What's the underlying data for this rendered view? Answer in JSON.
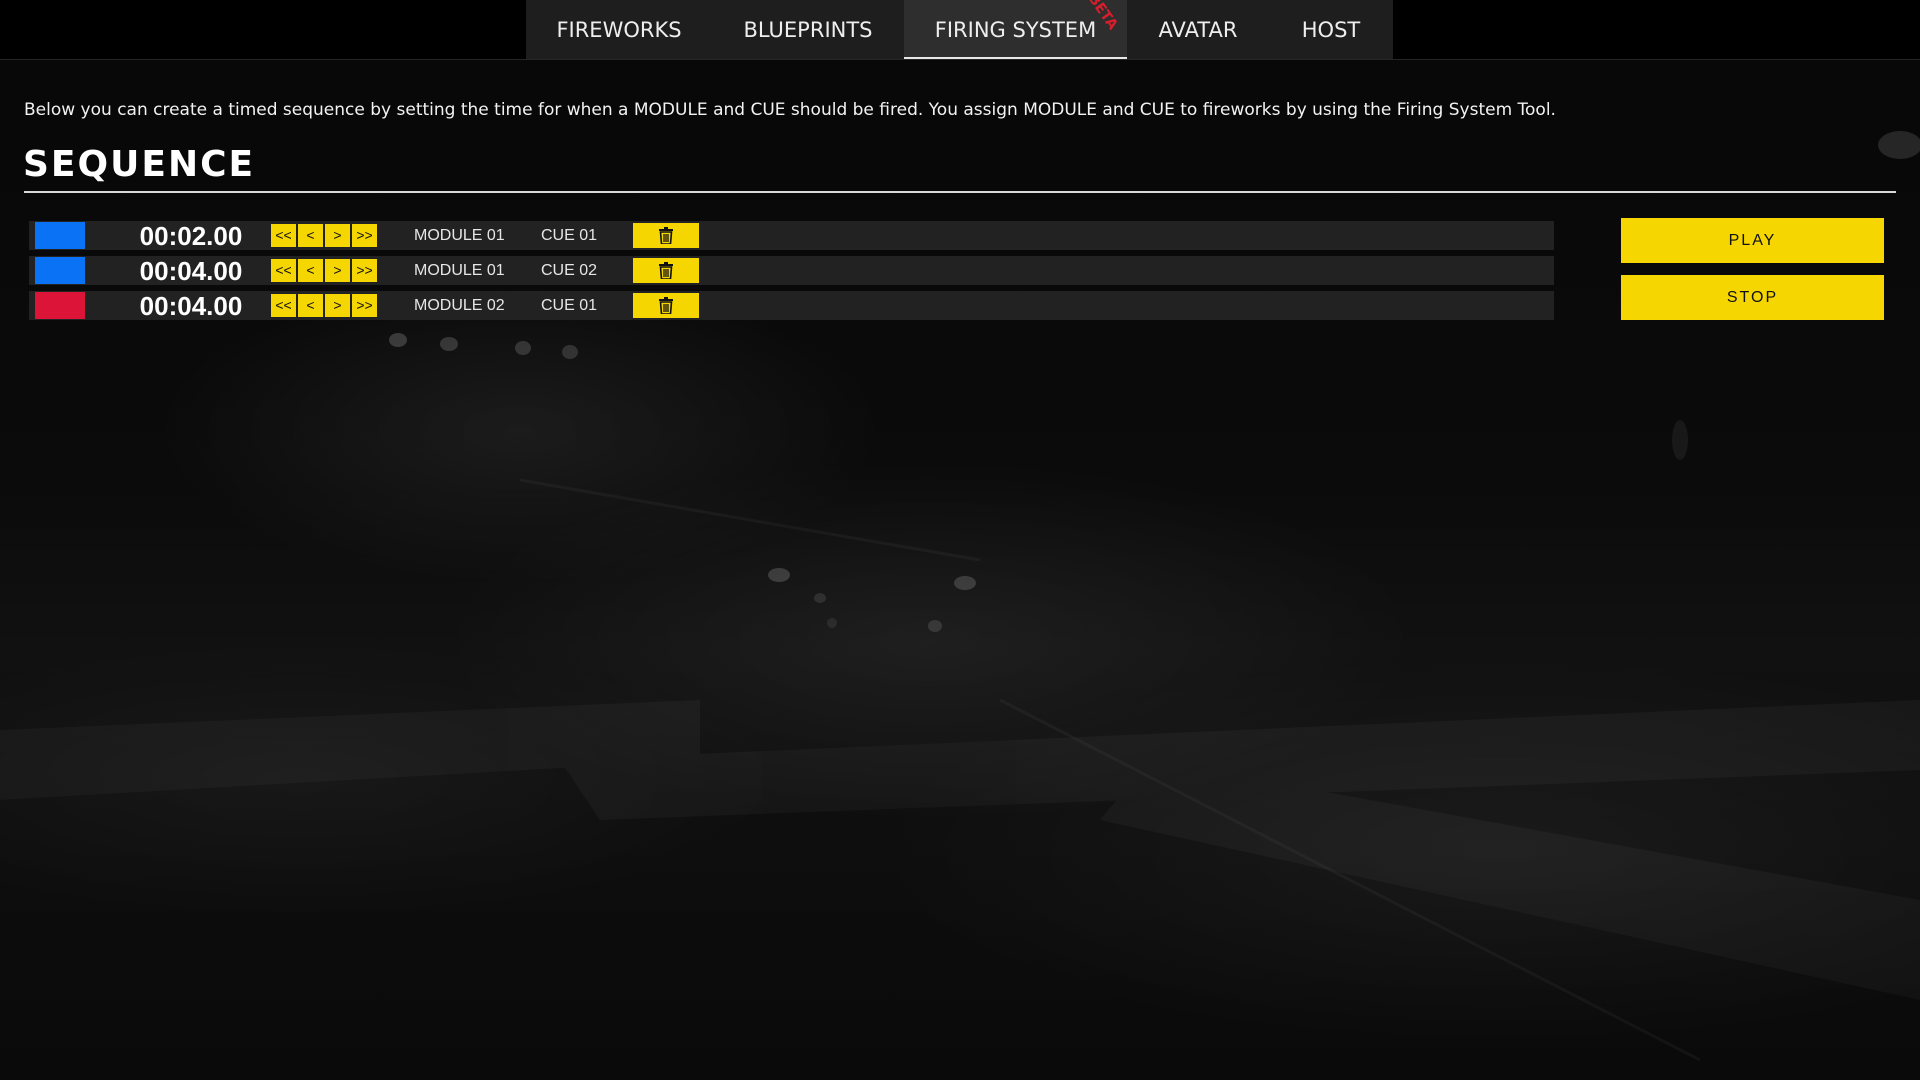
{
  "tabs": [
    {
      "label": "FIREWORKS"
    },
    {
      "label": "BLUEPRINTS"
    },
    {
      "label": "FIRING SYSTEM",
      "active": true,
      "badge": "BETA"
    },
    {
      "label": "AVATAR"
    },
    {
      "label": "HOST"
    }
  ],
  "intro_text": "Below you can create a timed sequence by setting the time for when a MODULE and CUE should be fired. You assign MODULE and CUE to fireworks by using the Firing System Tool.",
  "sequence": {
    "title": "SEQUENCE",
    "step_labels": {
      "back_big": "<<",
      "back": "<",
      "fwd": ">",
      "fwd_big": ">>"
    },
    "rows": [
      {
        "color": "#0a72f5",
        "time": "00:02.00",
        "module": "MODULE 01",
        "cue": "CUE 01"
      },
      {
        "color": "#0a72f5",
        "time": "00:04.00",
        "module": "MODULE 01",
        "cue": "CUE 02"
      },
      {
        "color": "#dc1538",
        "time": "00:04.00",
        "module": "MODULE 02",
        "cue": "CUE 01"
      }
    ]
  },
  "controls": {
    "play_label": "PLAY",
    "stop_label": "STOP"
  },
  "icons": {
    "delete": "trash-icon"
  },
  "colors": {
    "accent": "#f5d600",
    "beta_badge": "#d81e2c"
  }
}
